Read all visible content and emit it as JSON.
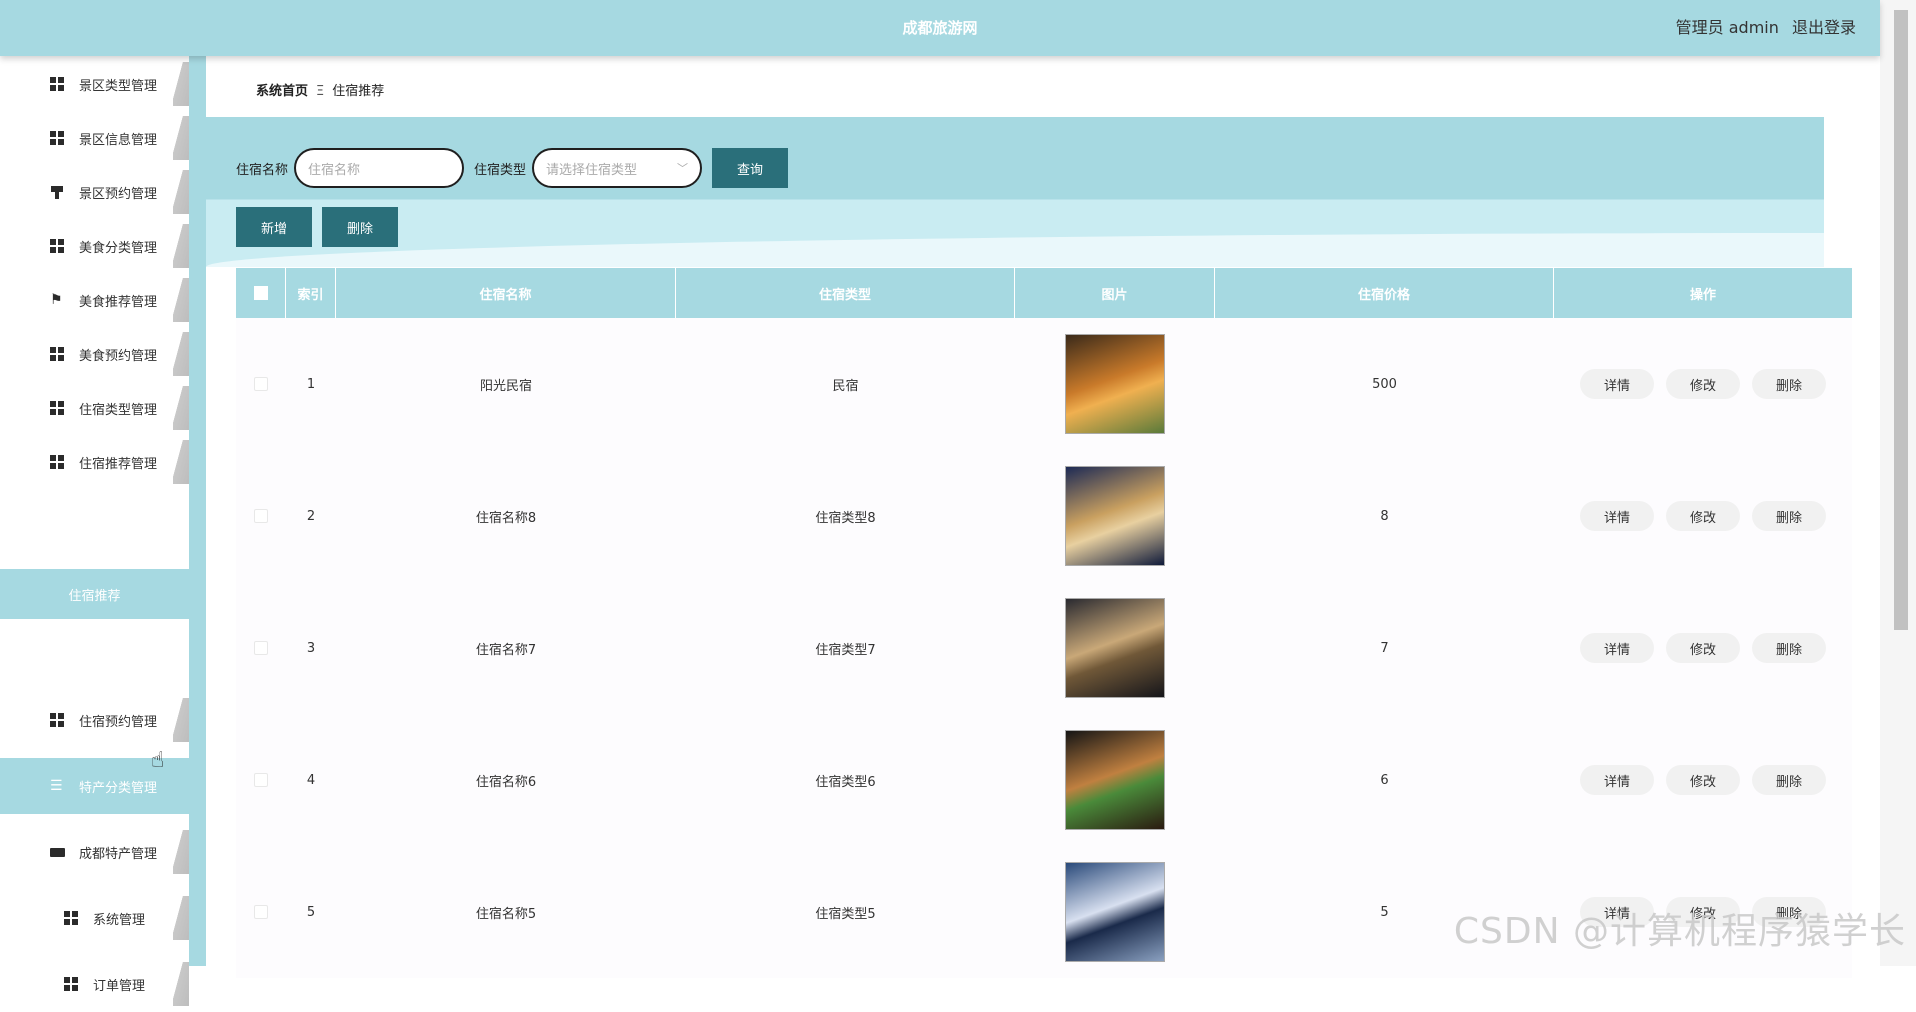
{
  "header": {
    "title": "成都旅游网",
    "user_label": "管理员 admin",
    "logout": "退出登录"
  },
  "sidebar": {
    "items": [
      {
        "label": "景区类型管理",
        "icon": "grid-icon"
      },
      {
        "label": "景区信息管理",
        "icon": "grid-icon"
      },
      {
        "label": "景区预约管理",
        "icon": "stamp-icon"
      },
      {
        "label": "美食分类管理",
        "icon": "grid-icon"
      },
      {
        "label": "美食推荐管理",
        "icon": "flag-icon"
      },
      {
        "label": "美食预约管理",
        "icon": "grid-icon"
      },
      {
        "label": "住宿类型管理",
        "icon": "grid-icon"
      },
      {
        "label": "住宿推荐管理",
        "icon": "grid-icon"
      }
    ],
    "sub_item": "住宿推荐",
    "items2": [
      {
        "label": "住宿预约管理",
        "icon": "grid-icon"
      },
      {
        "label": "特产分类管理",
        "icon": "list-icon"
      },
      {
        "label": "成都特产管理",
        "icon": "ticket-icon"
      },
      {
        "label": "系统管理",
        "icon": "grid-icon"
      },
      {
        "label": "订单管理",
        "icon": "grid-icon"
      }
    ]
  },
  "breadcrumb": {
    "home": "系统首页",
    "separator": "Ξ",
    "current": "住宿推荐"
  },
  "search": {
    "name_label": "住宿名称",
    "name_placeholder": "住宿名称",
    "type_label": "住宿类型",
    "type_placeholder": "请选择住宿类型",
    "query_button": "查询"
  },
  "actions": {
    "add": "新增",
    "delete": "删除"
  },
  "table": {
    "headers": [
      "索引",
      "住宿名称",
      "住宿类型",
      "图片",
      "住宿价格",
      "操作"
    ],
    "rows": [
      {
        "index": "1",
        "name": "阳光民宿",
        "type": "民宿",
        "price": "500"
      },
      {
        "index": "2",
        "name": "住宿名称8",
        "type": "住宿类型8",
        "price": "8"
      },
      {
        "index": "3",
        "name": "住宿名称7",
        "type": "住宿类型7",
        "price": "7"
      },
      {
        "index": "4",
        "name": "住宿名称6",
        "type": "住宿类型6",
        "price": "6"
      },
      {
        "index": "5",
        "name": "住宿名称5",
        "type": "住宿类型5",
        "price": "5"
      }
    ],
    "row_actions": [
      "详情",
      "修改",
      "删除"
    ]
  },
  "watermark": "CSDN @计算机程序猿学长",
  "colors": {
    "accent": "#a6d9e1",
    "button_dark": "#2a6f7a"
  }
}
